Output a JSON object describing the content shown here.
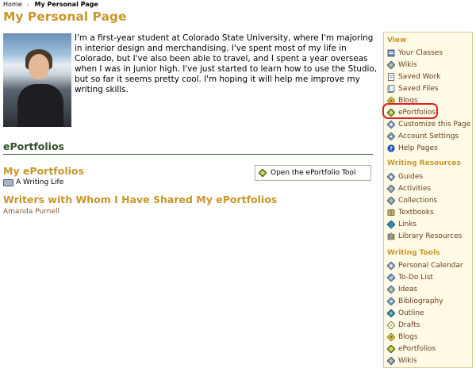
{
  "breadcrumb": {
    "home": "Home",
    "separator": "›",
    "current": "My Personal Page"
  },
  "page": {
    "title": "My Personal Page",
    "bio": "I'm a first-year student at Colorado State University, where I'm majoring in interior design and merchandising. I've spent most of my life in Colorado, but I've also been able to travel, and I spent a year overseas when I was in junior high. I've just started to learn how to use the Studio, but so far it seems pretty cool. I'm hoping it will help me improve my writing skills."
  },
  "eportfolios": {
    "section_title": "ePortfolios",
    "my_title": "My ePortfolios",
    "items": [
      {
        "label": "A Writing Life",
        "icon": "book-icon"
      }
    ],
    "open_tool_label": "Open the ePortfolio Tool",
    "shared_title": "Writers with Whom I Have Shared My ePortfolios",
    "shared_writers": [
      "Amanda Purnell"
    ]
  },
  "sidebar": {
    "view": {
      "heading": "View",
      "items": [
        {
          "label": "Your Classes",
          "icon": "classes-icon"
        },
        {
          "label": "Wikis",
          "icon": "wiki-icon"
        },
        {
          "label": "Saved Work",
          "icon": "saved-work-icon"
        },
        {
          "label": "Saved Files",
          "icon": "saved-files-icon"
        },
        {
          "label": "Blogs",
          "icon": "blog-icon"
        },
        {
          "label": "ePortfolios",
          "icon": "eportfolio-icon"
        },
        {
          "label": "Customize this Page",
          "icon": "customize-icon"
        },
        {
          "label": "Account Settings",
          "icon": "settings-icon"
        },
        {
          "label": "Help Pages",
          "icon": "help-icon"
        }
      ]
    },
    "resources": {
      "heading": "Writing Resources",
      "items": [
        {
          "label": "Guides",
          "icon": "guide-icon"
        },
        {
          "label": "Activities",
          "icon": "activity-icon"
        },
        {
          "label": "Collections",
          "icon": "collection-icon"
        },
        {
          "label": "Textbooks",
          "icon": "textbook-icon"
        },
        {
          "label": "Links",
          "icon": "link-icon"
        },
        {
          "label": "Library Resources",
          "icon": "library-icon"
        }
      ]
    },
    "tools": {
      "heading": "Writing Tools",
      "items": [
        {
          "label": "Personal Calendar",
          "icon": "calendar-icon"
        },
        {
          "label": "To-Do List",
          "icon": "todo-icon"
        },
        {
          "label": "Ideas",
          "icon": "ideas-icon"
        },
        {
          "label": "Bibliography",
          "icon": "bibliography-icon"
        },
        {
          "label": "Outline",
          "icon": "outline-icon"
        },
        {
          "label": "Drafts",
          "icon": "drafts-icon"
        },
        {
          "label": "Blogs",
          "icon": "blog-icon"
        },
        {
          "label": "ePortfolios",
          "icon": "eportfolio-icon"
        },
        {
          "label": "Wikis",
          "icon": "wiki-icon"
        }
      ]
    }
  },
  "colors": {
    "title_gold": "#c8962a",
    "section_green": "#2f5229",
    "link_brown": "#6b3a1e",
    "sidebar_bg": "#fffbe6",
    "highlight_red": "#e02020"
  }
}
